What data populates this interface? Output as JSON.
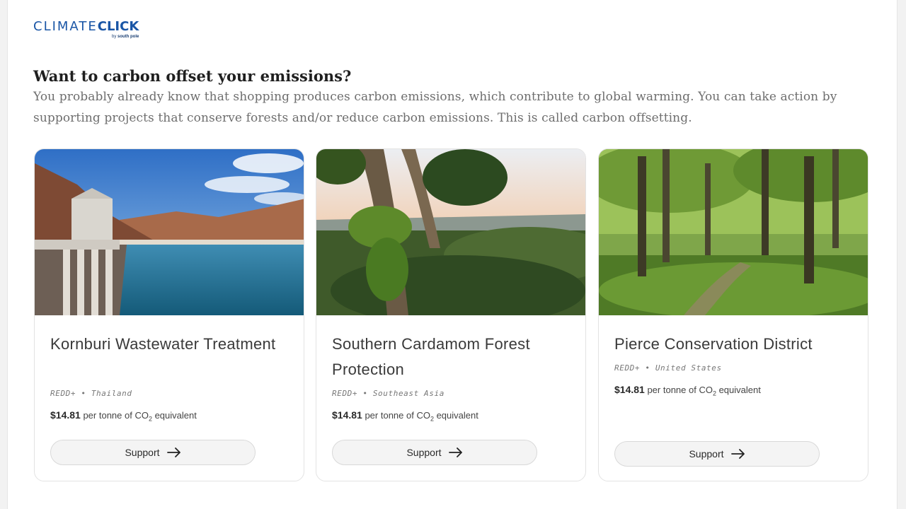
{
  "brand": {
    "name_light": "CLIMATE",
    "name_bold": "CLICK",
    "by_label": "by",
    "partner": "south pole",
    "color": "#1a56a6"
  },
  "intro": {
    "headline": "Want to carbon offset your emissions?",
    "body": "You probably already know that shopping produces carbon emissions, which contribute to global warming. You can take action by supporting projects that conserve forests and/or reduce carbon emissions. This is called carbon offsetting."
  },
  "projects": [
    {
      "title": "Kornburi Wastewater Treatment",
      "category": "REDD+",
      "separator": "•",
      "location": "Thailand",
      "price": "$14.81",
      "price_unit_prefix": "per tonne of CO",
      "price_unit_sub": "2",
      "price_unit_suffix": " equivalent",
      "button_label": "Support",
      "image_icon": "dam-lake-photo"
    },
    {
      "title": "Southern Cardamom Forest Protection",
      "category": "REDD+",
      "separator": "•",
      "location": "Southeast Asia",
      "price": "$14.81",
      "price_unit_prefix": "per tonne of CO",
      "price_unit_sub": "2",
      "price_unit_suffix": " equivalent",
      "button_label": "Support",
      "image_icon": "rainforest-canopy-photo"
    },
    {
      "title": "Pierce Conservation District",
      "category": "REDD+",
      "separator": "•",
      "location": "United States",
      "price": "$14.81",
      "price_unit_prefix": "per tonne of CO",
      "price_unit_sub": "2",
      "price_unit_suffix": " equivalent",
      "button_label": "Support",
      "image_icon": "mossy-forest-photo"
    }
  ]
}
